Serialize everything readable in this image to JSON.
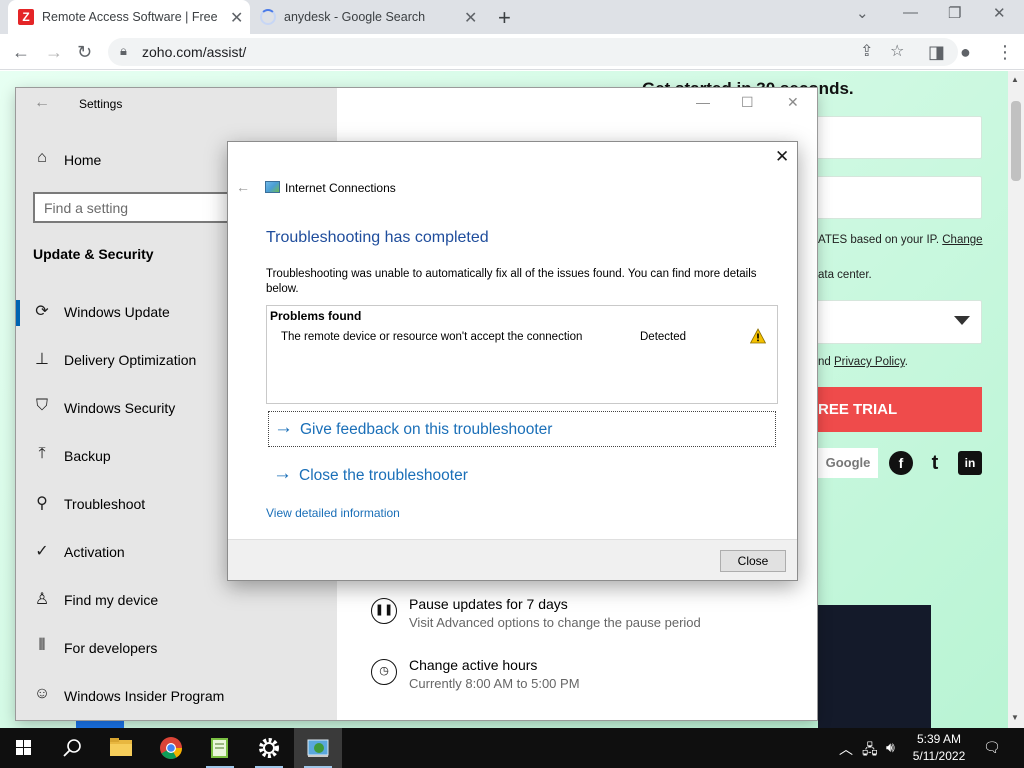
{
  "browser": {
    "tabs": [
      {
        "title": "Remote Access Software | Free R",
        "favicon_letter": "Z"
      },
      {
        "title": "anydesk - Google Search"
      }
    ],
    "url": "zoho.com/assist/"
  },
  "webpage": {
    "heading": "Get started in 30 seconds.",
    "states_text": "ATES based on your IP.",
    "change_link": "Change",
    "datacenter_text": "ata center.",
    "privacy_prefix": "nd",
    "privacy_link": "Privacy Policy",
    "privacy_suffix": ".",
    "trial_label": "REE TRIAL",
    "google_label": "Google",
    "social": [
      "f",
      "t",
      "in"
    ]
  },
  "settings": {
    "title": "Settings",
    "home_label": "Home",
    "search_placeholder": "Find a setting",
    "section_title": "Update & Security",
    "nav": [
      {
        "label": "Windows Update",
        "icon": "refresh-icon"
      },
      {
        "label": "Delivery Optimization",
        "icon": "delivery-icon"
      },
      {
        "label": "Windows Security",
        "icon": "shield-icon"
      },
      {
        "label": "Backup",
        "icon": "backup-icon"
      },
      {
        "label": "Troubleshoot",
        "icon": "wrench-icon"
      },
      {
        "label": "Activation",
        "icon": "check-circle-icon"
      },
      {
        "label": "Find my device",
        "icon": "person-icon"
      },
      {
        "label": "For developers",
        "icon": "developer-icon"
      },
      {
        "label": "Windows Insider Program",
        "icon": "insider-icon"
      }
    ],
    "options": [
      {
        "title": "Pause updates for 7 days",
        "subtitle": "Visit Advanced options to change the pause period"
      },
      {
        "title": "Change active hours",
        "subtitle": "Currently 8:00 AM to 5:00 PM"
      }
    ]
  },
  "dialog": {
    "app_title": "Internet Connections",
    "heading": "Troubleshooting has completed",
    "description": "Troubleshooting was unable to automatically fix all of the issues found. You can find more details below.",
    "problems_header": "Problems found",
    "problem": {
      "description": "The remote device or resource won't accept the connection",
      "status": "Detected"
    },
    "feedback_label": "Give feedback on this troubleshooter",
    "close_troubleshooter_label": "Close the troubleshooter",
    "details_link": "View detailed information",
    "close_button": "Close"
  },
  "taskbar": {
    "time": "5:39 AM",
    "date": "5/11/2022"
  }
}
